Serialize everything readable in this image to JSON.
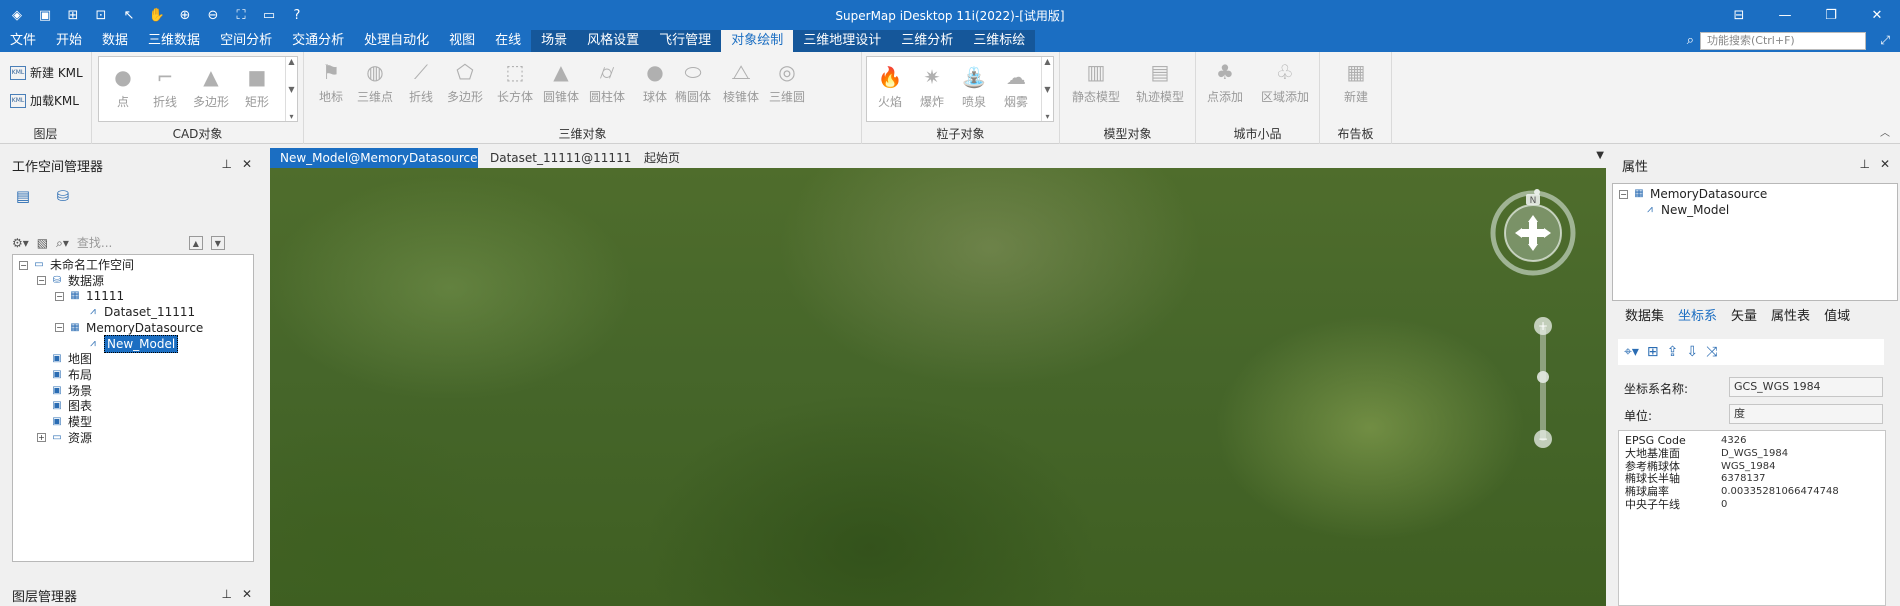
{
  "title": "SuperMap iDesktop 11i(2022)-[试用版]",
  "quick_access": [
    "app-icon",
    "save-icon",
    "new-workspace-icon",
    "open-workspace-icon",
    "pointer-icon",
    "pan-icon",
    "zoom-in-icon",
    "zoom-out-icon",
    "full-extent-icon",
    "open-folder-icon",
    "help-icon"
  ],
  "menu": {
    "items": [
      "文件",
      "开始",
      "数据",
      "三维数据",
      "空间分析",
      "交通分析",
      "处理自动化",
      "视图",
      "在线",
      "场景",
      "风格设置",
      "飞行管理",
      "对象绘制",
      "三维地理设计",
      "三维分析",
      "三维标绘"
    ],
    "active_index": 12,
    "contextual_start": 9,
    "search_placeholder": "功能搜索(Ctrl+F)"
  },
  "ribbon": {
    "layer_group": {
      "label": "图层",
      "buttons": [
        "新建 KML",
        "加载KML"
      ]
    },
    "cad_group": {
      "label": "CAD对象",
      "items": [
        "点",
        "折线",
        "多边形",
        "矩形"
      ]
    },
    "three_d_group": {
      "label": "三维对象",
      "items": [
        "地标",
        "三维点",
        "折线",
        "多边形",
        "长方体",
        "圆锥体",
        "圆柱体",
        "球体",
        "椭圆体",
        "棱锥体",
        "三维圆"
      ]
    },
    "particle_group": {
      "label": "粒子对象",
      "items": [
        "火焰",
        "爆炸",
        "喷泉",
        "烟雾"
      ]
    },
    "model_group": {
      "label": "模型对象",
      "items": [
        "静态模型",
        "轨迹模型"
      ]
    },
    "city_group": {
      "label": "城市小品",
      "items": [
        "点添加",
        "区域添加"
      ]
    },
    "billboard_group": {
      "label": "布告板",
      "items": [
        "新建"
      ]
    }
  },
  "workspace_panel": {
    "title": "工作空间管理器",
    "search_placeholder": "查找...",
    "tree": [
      {
        "label": "未命名工作空间",
        "level": 0,
        "toggle": "−"
      },
      {
        "label": "数据源",
        "level": 1,
        "toggle": "−"
      },
      {
        "label": "11111",
        "level": 2,
        "toggle": "−"
      },
      {
        "label": "Dataset_11111",
        "level": 3,
        "toggle": ""
      },
      {
        "label": "MemoryDatasource",
        "level": 2,
        "toggle": "−"
      },
      {
        "label": "New_Model",
        "level": 3,
        "toggle": "",
        "selected": true
      },
      {
        "label": "地图",
        "level": 1,
        "toggle": ""
      },
      {
        "label": "布局",
        "level": 1,
        "toggle": ""
      },
      {
        "label": "场景",
        "level": 1,
        "toggle": ""
      },
      {
        "label": "图表",
        "level": 1,
        "toggle": ""
      },
      {
        "label": "模型",
        "level": 1,
        "toggle": ""
      },
      {
        "label": "资源",
        "level": 1,
        "toggle": "+"
      }
    ]
  },
  "layer_panel": {
    "title": "图层管理器"
  },
  "doc_tabs": [
    "New_Model@MemoryDatasource",
    "Dataset_11111@11111",
    "起始页"
  ],
  "scene": {
    "compass_label": "N"
  },
  "properties_panel": {
    "title": "属性",
    "tree": [
      "MemoryDatasource",
      "New_Model"
    ],
    "tabs": [
      "数据集",
      "坐标系",
      "矢量",
      "属性表",
      "值域"
    ],
    "active_tab": 1,
    "cs_name_label": "坐标系名称:",
    "cs_name_value": "GCS_WGS 1984",
    "unit_label": "单位:",
    "unit_value": "度",
    "cs_details": [
      {
        "k": "EPSG Code",
        "v": "4326"
      },
      {
        "k": "大地基准面",
        "v": "D_WGS_1984"
      },
      {
        "k": "参考椭球体",
        "v": "WGS_1984"
      },
      {
        "k": "椭球长半轴",
        "v": "6378137"
      },
      {
        "k": "椭球扁率",
        "v": "0.00335281066474748"
      },
      {
        "k": "中央子午线",
        "v": "0"
      }
    ]
  }
}
